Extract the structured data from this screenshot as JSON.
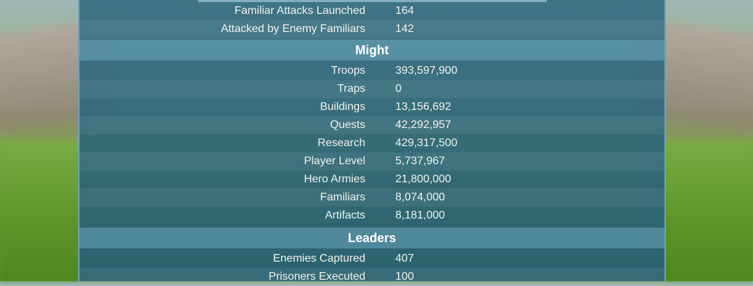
{
  "combat": [
    {
      "label": "Familiar Attacks Launched",
      "value": "164"
    },
    {
      "label": "Attacked by Enemy Familiars",
      "value": "142"
    }
  ],
  "might": {
    "title": "Might",
    "rows": [
      {
        "label": "Troops",
        "value": "393,597,900"
      },
      {
        "label": "Traps",
        "value": "0"
      },
      {
        "label": "Buildings",
        "value": "13,156,692"
      },
      {
        "label": "Quests",
        "value": "42,292,957"
      },
      {
        "label": "Research",
        "value": "429,317,500"
      },
      {
        "label": "Player Level",
        "value": "5,737,967"
      },
      {
        "label": "Hero Armies",
        "value": "21,800,000"
      },
      {
        "label": "Familiars",
        "value": "8,074,000"
      },
      {
        "label": "Artifacts",
        "value": "8,181,000"
      }
    ]
  },
  "leaders": {
    "title": "Leaders",
    "rows": [
      {
        "label": "Enemies Captured",
        "value": "407"
      },
      {
        "label": "Prisoners Executed",
        "value": "100"
      }
    ]
  }
}
